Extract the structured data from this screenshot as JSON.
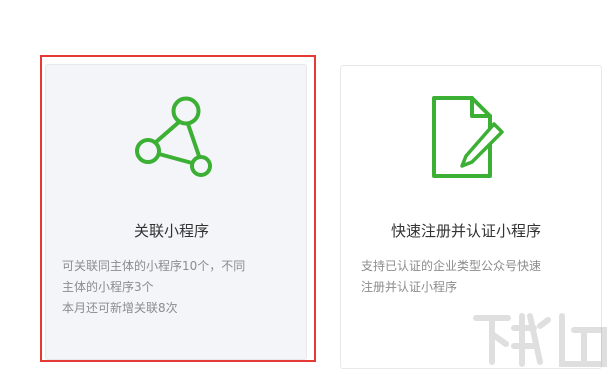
{
  "cards": {
    "link_miniprogram": {
      "title": "关联小程序",
      "desc_line1": "可关联同主体的小程序10个，不同",
      "desc_line2": "主体的小程序3个",
      "desc_line3": "本月还可新增关联8次",
      "icon": "network-nodes-icon"
    },
    "register_miniprogram": {
      "title": "快速注册并认证小程序",
      "desc_line1": "支持已认证的企业类型公众号快速",
      "desc_line2": "注册并认证小程序",
      "icon": "document-pencil-icon"
    }
  },
  "colors": {
    "accent_green": "#3cb034",
    "highlight_red": "#e53935",
    "card_bg_active": "#f4f5f9",
    "card_border": "#e6e8eb",
    "title_text": "#333333",
    "desc_text": "#8c8c8c"
  },
  "watermark": {
    "text": "下载吧"
  }
}
